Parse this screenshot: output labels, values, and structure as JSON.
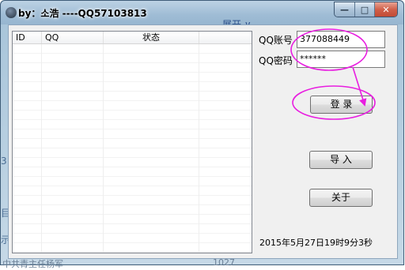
{
  "window": {
    "title": "by：소浩 ----QQ57103813",
    "controls": {
      "minimize": "—",
      "maximize": "□",
      "close": "✕"
    }
  },
  "background": {
    "top_fragment": "展开 ∨",
    "left_fragments": [
      "3",
      "目",
      "示"
    ],
    "bottom_left": "中共青主任杨军",
    "bottom_mid": "1027"
  },
  "list": {
    "columns": [
      "ID",
      "QQ",
      "状态",
      ""
    ]
  },
  "login": {
    "account_label": "QQ账号",
    "account_value": "377088449",
    "password_label": "QQ密码",
    "password_value": "******",
    "login_button": "登  录",
    "import_button": "导  入",
    "about_button": "关于"
  },
  "status": {
    "datetime": "2015年5月27日19时9分3秒"
  },
  "colors": {
    "annotation": "#e81ee0",
    "title_bar": "#a9c5da",
    "close_button": "#c9533d"
  }
}
